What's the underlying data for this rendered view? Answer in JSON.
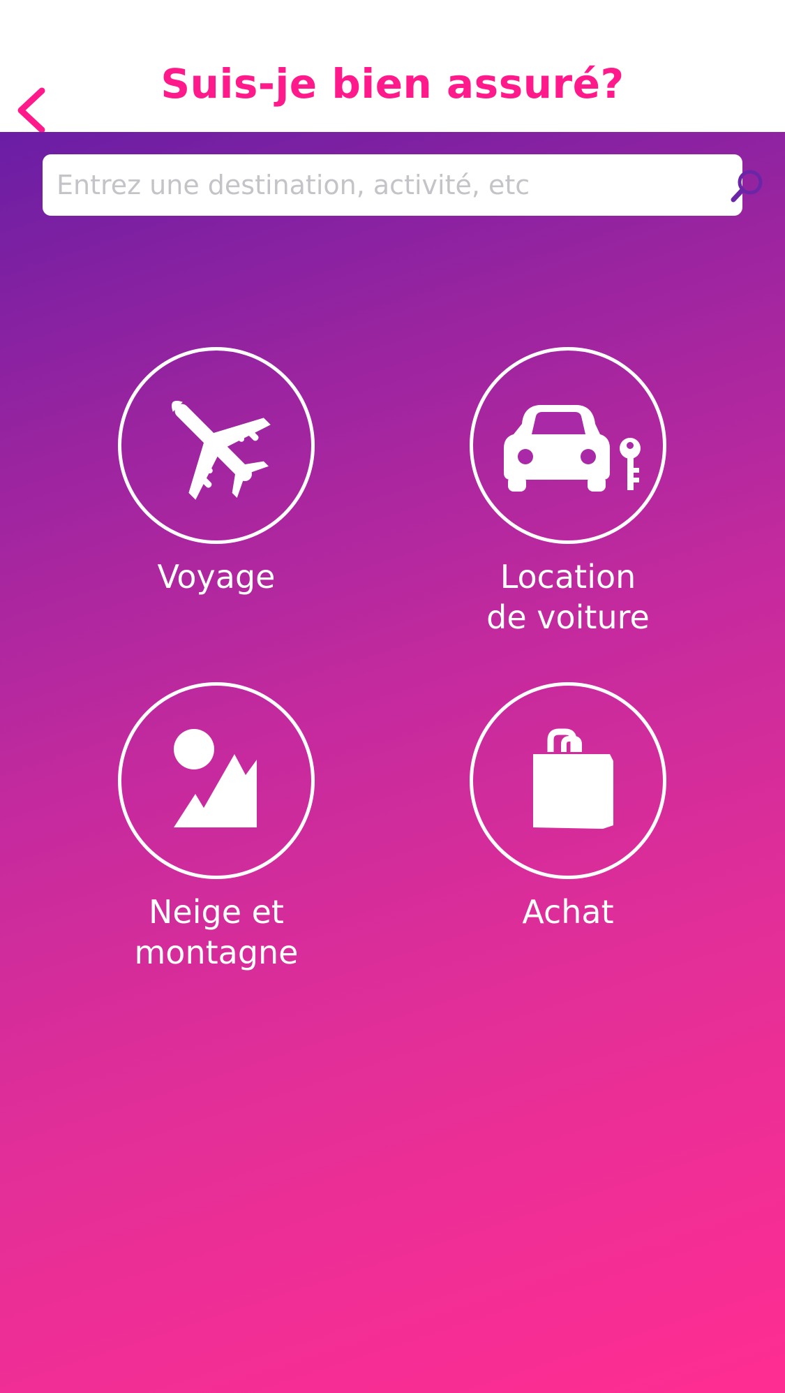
{
  "header": {
    "title": "Suis-je bien assuré?",
    "accent_color": "#ff1a8c"
  },
  "search": {
    "placeholder": "Entrez une destination, activité, etc",
    "value": "",
    "icon": "search-icon",
    "icon_color": "#6b26a8"
  },
  "categories": [
    {
      "label": "Voyage",
      "icon": "airplane-icon"
    },
    {
      "label": "Location\nde voiture",
      "icon": "car-key-icon"
    },
    {
      "label": "Neige et\nmontagne",
      "icon": "mountain-sun-icon"
    },
    {
      "label": "Achat",
      "icon": "shopping-bag-icon"
    }
  ],
  "background": {
    "gradient_top": "#6a1ea4",
    "gradient_bottom": "#ff2d92"
  }
}
